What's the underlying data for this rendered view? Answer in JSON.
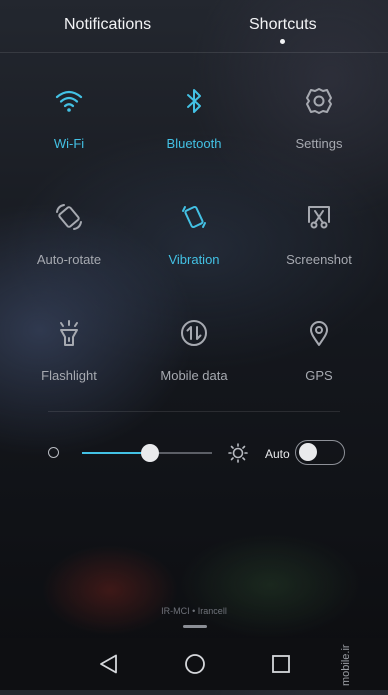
{
  "header": {
    "tabs": [
      {
        "label": "Notifications"
      },
      {
        "label": "Shortcuts",
        "selected": true
      }
    ]
  },
  "shortcuts": [
    {
      "label": "Wi-Fi",
      "icon": "wifi-icon",
      "active": true
    },
    {
      "label": "Bluetooth",
      "icon": "bluetooth-icon",
      "active": true
    },
    {
      "label": "Settings",
      "icon": "gear-icon",
      "active": false
    },
    {
      "label": "Auto-rotate",
      "icon": "auto-rotate-icon",
      "active": false
    },
    {
      "label": "Vibration",
      "icon": "vibration-icon",
      "active": true
    },
    {
      "label": "Screenshot",
      "icon": "screenshot-icon",
      "active": false
    },
    {
      "label": "Flashlight",
      "icon": "flashlight-icon",
      "active": false
    },
    {
      "label": "Mobile data",
      "icon": "mobile-data-icon",
      "active": false
    },
    {
      "label": "GPS",
      "icon": "gps-icon",
      "active": false
    }
  ],
  "brightness": {
    "level_percent": 52,
    "auto_label": "Auto",
    "auto_enabled": false
  },
  "footer": {
    "carrier_text": "IR-MCI • Irancell",
    "watermark": "mobile.ir"
  },
  "colors": {
    "accent": "#43c1e4",
    "inactive": "#a6a9b0"
  }
}
